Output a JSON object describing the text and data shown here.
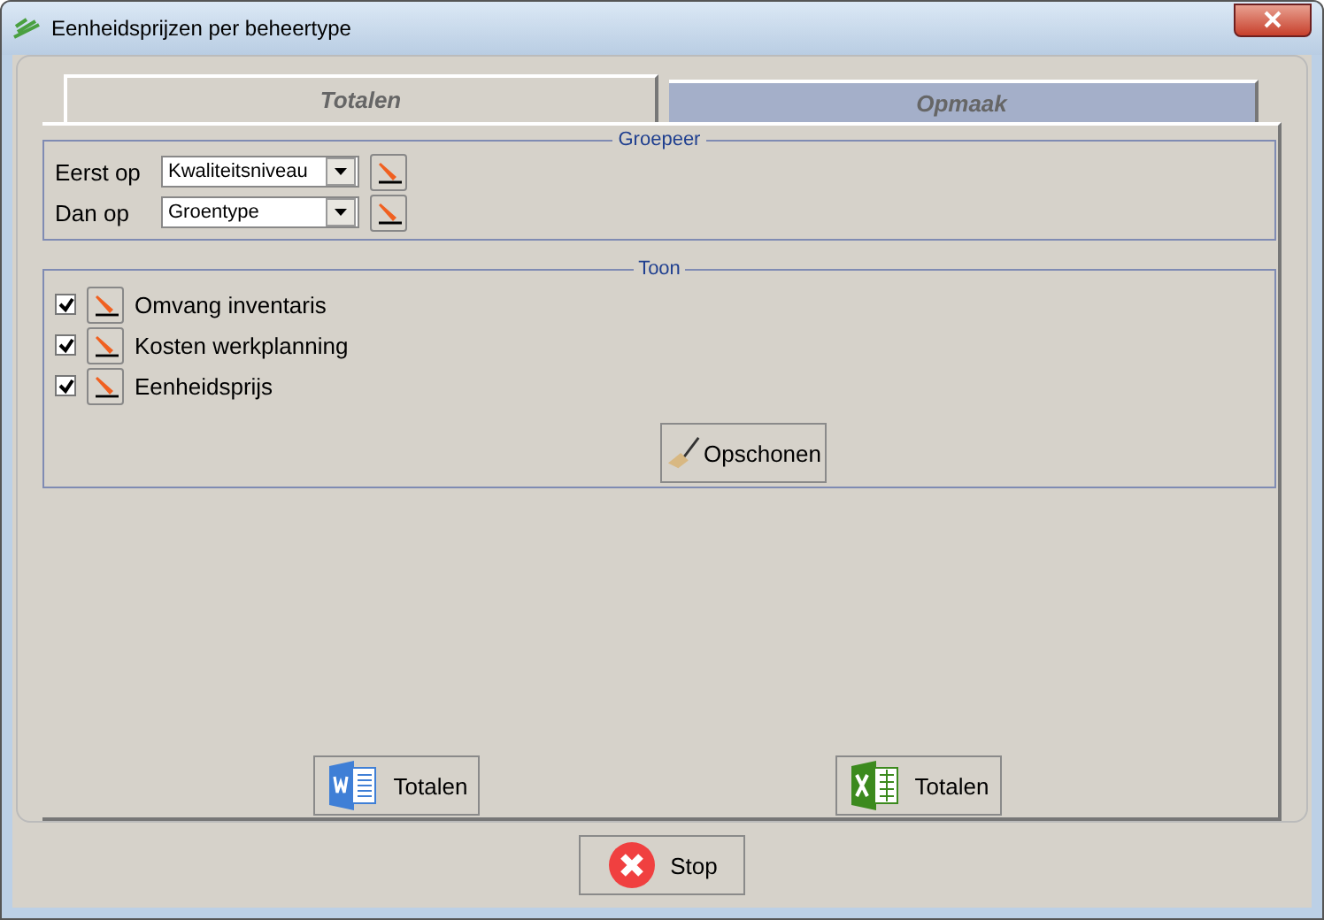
{
  "window": {
    "title": "Eenheidsprijzen per beheertype"
  },
  "tabs": [
    {
      "label": "Totalen",
      "selected": true
    },
    {
      "label": "Opmaak",
      "selected": false
    }
  ],
  "groepeer": {
    "title": "Groepeer",
    "rows": [
      {
        "label": "Eerst op",
        "value": "Kwaliteitsniveau"
      },
      {
        "label": "Dan op",
        "value": "Groentype"
      }
    ]
  },
  "toon": {
    "title": "Toon",
    "items": [
      {
        "label": "Omvang inventaris",
        "checked": true
      },
      {
        "label": "Kosten werkplanning",
        "checked": true
      },
      {
        "label": "Eenheidsprijs",
        "checked": true
      }
    ],
    "clear_button": "Opschonen"
  },
  "export_buttons": [
    {
      "kind": "word",
      "label": "Totalen"
    },
    {
      "kind": "excel",
      "label": "Totalen"
    }
  ],
  "stop_button": "Stop"
}
